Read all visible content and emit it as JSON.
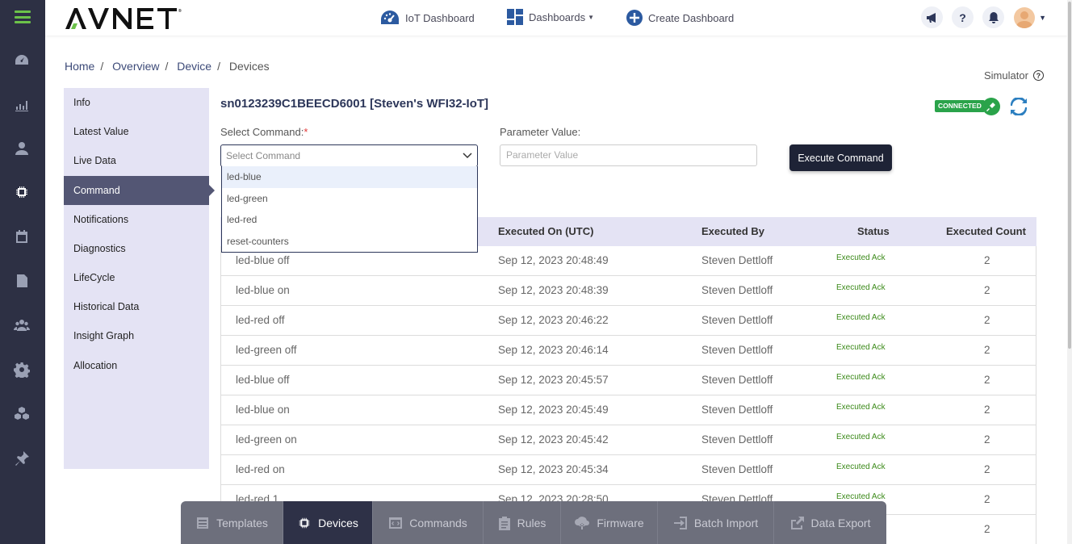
{
  "app": {
    "logo": "AVNET",
    "logo_mark": "®"
  },
  "topnav": {
    "iot_dashboard": "IoT Dashboard",
    "dashboards": "Dashboards",
    "create_dashboard": "Create Dashboard",
    "help": "?"
  },
  "breadcrumb": {
    "items": [
      "Home",
      "Overview",
      "Device",
      "Devices"
    ],
    "separator": "/"
  },
  "simulator": {
    "label": "Simulator",
    "help": "?"
  },
  "sidemenu": {
    "items": [
      "Info",
      "Latest Value",
      "Live Data",
      "Command",
      "Notifications",
      "Diagnostics",
      "LifeCycle",
      "Historical Data",
      "Insight Graph",
      "Allocation"
    ],
    "active": "Command"
  },
  "device": {
    "title": "sn0123239C1BEECD6001 [Steven's WFI32-IoT]",
    "status_badge": "CONNECTED"
  },
  "form": {
    "select_label": "Select Command:",
    "required_mark": "*",
    "select_placeholder": "Select Command",
    "param_label": "Parameter Value:",
    "param_placeholder": "Parameter Value",
    "execute_button": "Execute Command",
    "options": [
      "led-blue",
      "led-green",
      "led-red",
      "reset-counters"
    ],
    "highlighted_option": "led-blue"
  },
  "table": {
    "headers": [
      "Executed On (UTC)",
      "Executed By",
      "Status",
      "Executed Count"
    ],
    "rows": [
      {
        "command": "led-blue off",
        "on": "Sep 12, 2023 20:48:49",
        "by": "Steven Dettloff",
        "status": "Executed Ack",
        "count": "2"
      },
      {
        "command": "led-blue on",
        "on": "Sep 12, 2023 20:48:39",
        "by": "Steven Dettloff",
        "status": "Executed Ack",
        "count": "2"
      },
      {
        "command": "led-red off",
        "on": "Sep 12, 2023 20:46:22",
        "by": "Steven Dettloff",
        "status": "Executed Ack",
        "count": "2"
      },
      {
        "command": "led-green off",
        "on": "Sep 12, 2023 20:46:14",
        "by": "Steven Dettloff",
        "status": "Executed Ack",
        "count": "2"
      },
      {
        "command": "led-blue off",
        "on": "Sep 12, 2023 20:45:57",
        "by": "Steven Dettloff",
        "status": "Executed Ack",
        "count": "2"
      },
      {
        "command": "led-blue on",
        "on": "Sep 12, 2023 20:45:49",
        "by": "Steven Dettloff",
        "status": "Executed Ack",
        "count": "2"
      },
      {
        "command": "led-green on",
        "on": "Sep 12, 2023 20:45:42",
        "by": "Steven Dettloff",
        "status": "Executed Ack",
        "count": "2"
      },
      {
        "command": "led-red on",
        "on": "Sep 12, 2023 20:45:34",
        "by": "Steven Dettloff",
        "status": "Executed Ack",
        "count": "2"
      },
      {
        "command": "led-red 1",
        "on": "Sep 12, 2023 20:28:50",
        "by": "Steven Dettloff",
        "status": "Executed Ack",
        "count": "2"
      },
      {
        "command": "",
        "on": "",
        "by": "",
        "status": "",
        "count": "2"
      }
    ]
  },
  "dock": {
    "items": [
      "Templates",
      "Devices",
      "Commands",
      "Rules",
      "Firmware",
      "Batch Import",
      "Data Export"
    ],
    "active": "Devices"
  },
  "colors": {
    "rail_bg": "#2d3044",
    "accent_green": "#6cc24a",
    "connected_green": "#2aa34a",
    "menu_bg": "#e4e3f4",
    "menu_active": "#535674",
    "navy": "#2c3659",
    "dock_bg": "#6d6f7c",
    "dock_active": "#2e3147"
  }
}
